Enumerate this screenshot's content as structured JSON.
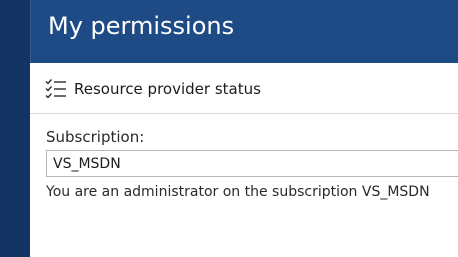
{
  "blade": {
    "title": "My permissions"
  },
  "command_bar": {
    "resource_provider_label": "Resource provider status",
    "resource_provider_icon": "checklist-icon"
  },
  "subscription": {
    "label": "Subscription:",
    "value": "VS_MSDN",
    "note": "You are an administrator on the subscription VS_MSDN"
  },
  "colors": {
    "header_bg": "#1e4b86",
    "portal_bg": "#143463"
  }
}
